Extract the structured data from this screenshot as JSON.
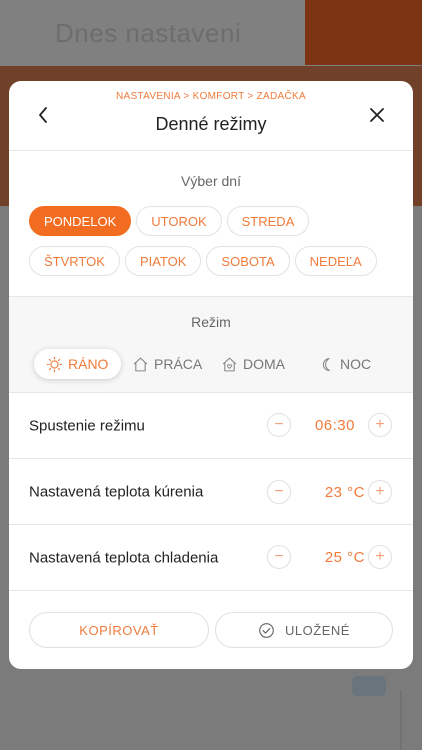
{
  "background": {
    "title": "Dnes nastaveni"
  },
  "modal": {
    "breadcrumb": "NASTAVENIA > KOMFORT > ZADAČKA",
    "title": "Denné režimy"
  },
  "days": {
    "label": "Výber dní",
    "items": [
      {
        "label": "PONDELOK",
        "active": true
      },
      {
        "label": "UTOROK",
        "active": false
      },
      {
        "label": "STREDA",
        "active": false
      },
      {
        "label": "ŠTVRTOK",
        "active": false
      },
      {
        "label": "PIATOK",
        "active": false
      },
      {
        "label": "SOBOTA",
        "active": false
      },
      {
        "label": "NEDEĽA",
        "active": false
      }
    ]
  },
  "modes": {
    "label": "Režim",
    "items": [
      {
        "label": "RÁNO",
        "icon": "sun-icon",
        "active": true
      },
      {
        "label": "PRÁCA",
        "icon": "house-icon",
        "active": false
      },
      {
        "label": "DOMA",
        "icon": "home-heart-icon",
        "active": false
      },
      {
        "label": "NOC",
        "icon": "moon-icon",
        "active": false
      }
    ]
  },
  "settings": {
    "start": {
      "label": "Spustenie režimu",
      "value": "06:30"
    },
    "heating": {
      "label": "Nastavená teplota kúrenia",
      "value": "23 °C"
    },
    "cooling": {
      "label": "Nastavená teplota chladenia",
      "value": "25 °C"
    }
  },
  "footer": {
    "copy_label": "KOPÍROVAŤ",
    "saved_label": "ULOŽENÉ"
  },
  "colors": {
    "accent": "#f26c22",
    "accent_text": "#f07b3b"
  }
}
